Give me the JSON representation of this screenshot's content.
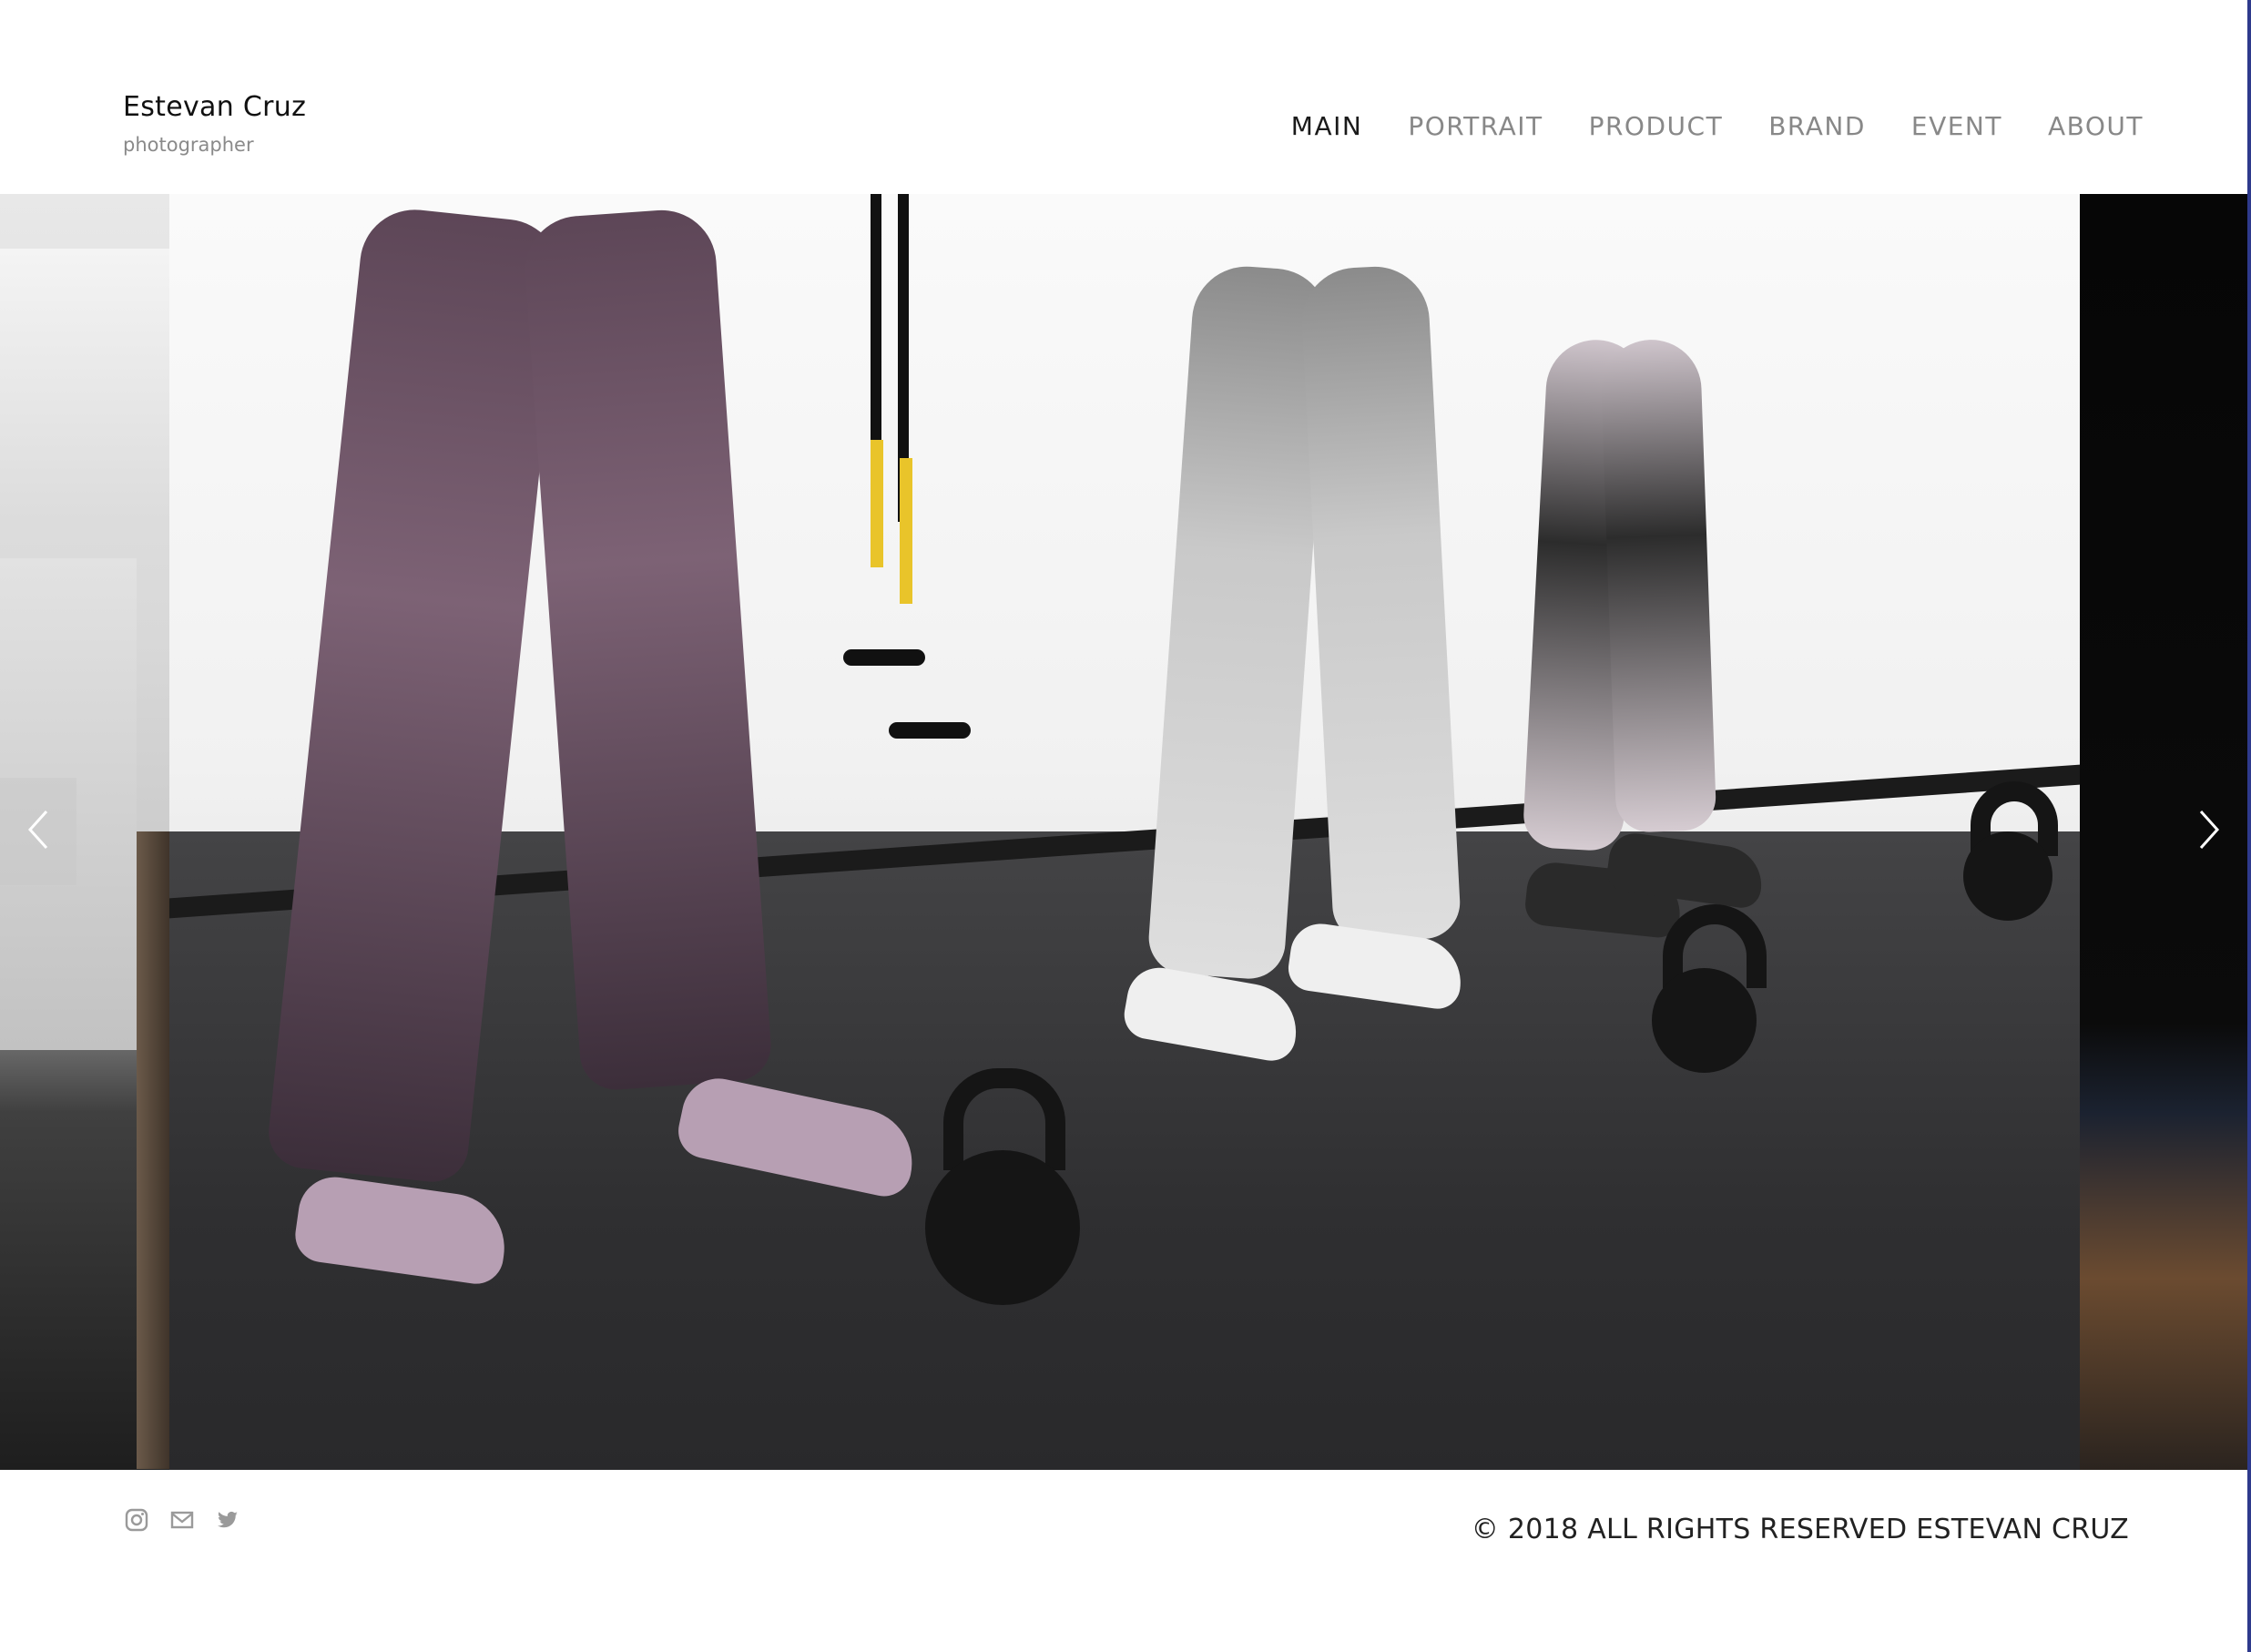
{
  "header": {
    "name": "Estevan Cruz",
    "subtitle": "photographer"
  },
  "nav": {
    "items": [
      {
        "label": "MAIN",
        "active": true
      },
      {
        "label": "PORTRAIT",
        "active": false
      },
      {
        "label": "PRODUCT",
        "active": false
      },
      {
        "label": "BRAND",
        "active": false
      },
      {
        "label": "EVENT",
        "active": false
      },
      {
        "label": "ABOUT",
        "active": false
      }
    ]
  },
  "slider": {
    "prev_icon": "chevron-left-icon",
    "next_icon": "chevron-right-icon"
  },
  "footer": {
    "social": [
      {
        "icon": "instagram-icon"
      },
      {
        "icon": "mail-icon"
      },
      {
        "icon": "twitter-icon"
      }
    ],
    "copyright": "© 2018 ALL RIGHTS RESERVED ESTEVAN CRUZ"
  },
  "colors": {
    "nav_active": "#1a1a1a",
    "nav_inactive": "#888888",
    "subtitle": "#8a8a8a",
    "icon": "#9a9a9a"
  }
}
